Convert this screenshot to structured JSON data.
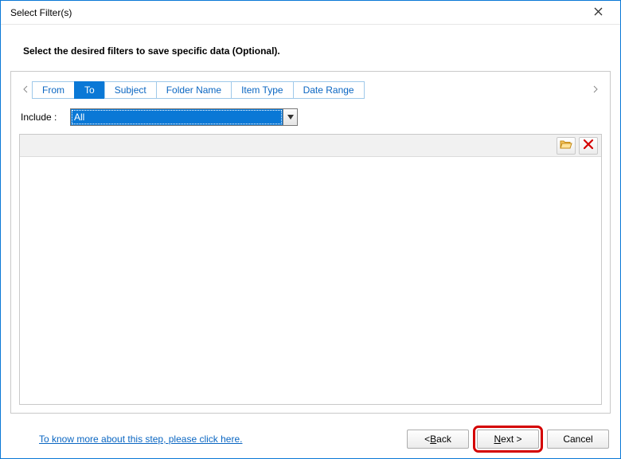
{
  "window": {
    "title": "Select Filter(s)"
  },
  "instruction": "Select the desired filters to save specific data (Optional).",
  "tabs": {
    "items": [
      {
        "label": "From"
      },
      {
        "label": "To"
      },
      {
        "label": "Subject"
      },
      {
        "label": "Folder Name"
      },
      {
        "label": "Item Type"
      },
      {
        "label": "Date Range"
      }
    ],
    "active_index": 1
  },
  "include": {
    "label": "Include :",
    "value": "All"
  },
  "toolbar_icons": {
    "browse": "folder-open-icon",
    "delete": "x-red-icon"
  },
  "help_link": "To know more about this step, please click here.",
  "buttons": {
    "back_prefix": "< ",
    "back_u": "B",
    "back_rest": "ack",
    "next_u": "N",
    "next_rest": "ext >",
    "cancel": "Cancel"
  }
}
